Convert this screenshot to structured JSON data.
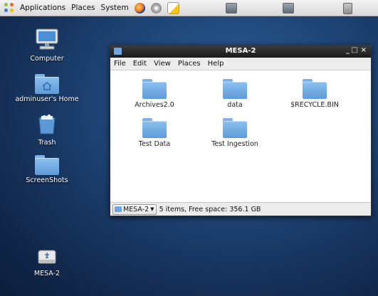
{
  "panel": {
    "applications": "Applications",
    "places": "Places",
    "system": "System"
  },
  "desktop": {
    "computer": "Computer",
    "home": "adminuser's Home",
    "trash": "Trash",
    "screenshots": "ScreenShots",
    "mesa": "MESA-2"
  },
  "window": {
    "title": "MESA-2",
    "minimize": "_",
    "maximize": "□",
    "close": "×",
    "menu": [
      "File",
      "Edit",
      "View",
      "Places",
      "Help"
    ],
    "items": [
      "Archives2.0",
      "data",
      "$RECYCLE.BIN",
      "Test Data",
      "Test Ingestion"
    ],
    "location": "MESA-2",
    "status": "5 items, Free space: 356.1 GB"
  },
  "colors": {
    "folder": "#5d9bd8",
    "titlebar": "#2a2a2a",
    "desktop": "#1f4577"
  }
}
